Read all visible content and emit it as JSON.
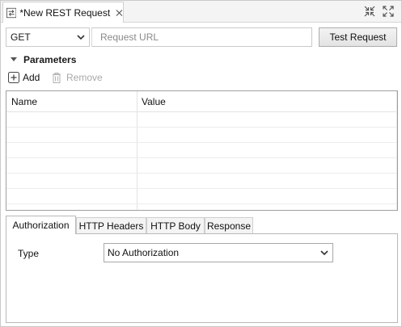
{
  "editor": {
    "tab_title": "*New REST Request",
    "tab_icon": "rest-request-icon",
    "close_icon": "close-icon",
    "minimize_icon": "minimize-icon",
    "maximize_icon": "maximize-icon"
  },
  "request": {
    "method": "GET",
    "url_value": "",
    "url_placeholder": "Request URL",
    "test_button": "Test Request"
  },
  "parameters": {
    "title": "Parameters",
    "add_label": "Add",
    "remove_label": "Remove",
    "columns": [
      "Name",
      "Value"
    ],
    "rows": []
  },
  "bottom_tabs": [
    {
      "label": "Authorization",
      "active": true
    },
    {
      "label": "HTTP Headers",
      "active": false
    },
    {
      "label": "HTTP Body",
      "active": false
    },
    {
      "label": "Response",
      "active": false
    }
  ],
  "authorization": {
    "type_label": "Type",
    "type_value": "No Authorization"
  },
  "colors": {
    "border": "#c9c9c9",
    "accent": "#1a1a1a",
    "disabled_text": "#a8a8a8"
  }
}
